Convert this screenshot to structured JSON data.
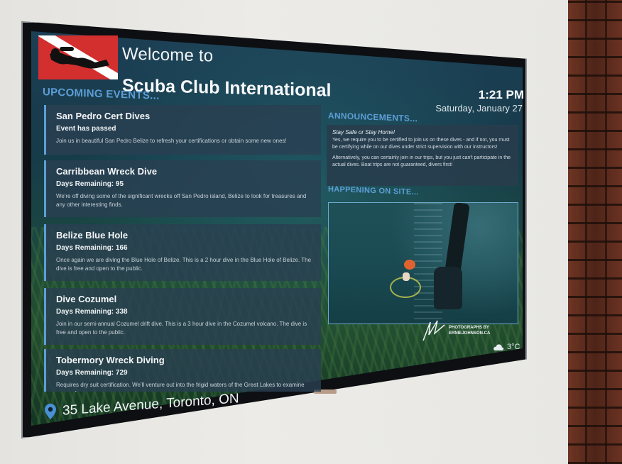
{
  "header": {
    "welcome": "Welcome to",
    "club_name": "Scuba Club International",
    "time": "1:21 PM",
    "date": "Saturday, January 27"
  },
  "events": {
    "title": "UPCOMING EVENTS...",
    "items": [
      {
        "name": "San Pedro Cert Dives",
        "status": "Event has passed",
        "description": "Join us in beautiful San Pedro Belize to refresh your certifications or obtain some new ones!"
      },
      {
        "name": "Carribbean Wreck Dive",
        "status": "Days Remaining: 95",
        "description": "We're off diving some of the significant wrecks off San Pedro island, Belize to look for treasures and any other interesting finds."
      },
      {
        "name": "Belize Blue Hole",
        "status": "Days Remaining: 166",
        "description": "Once again we are diving the Blue Hole of Belize. This is a 2 hour dive in the Blue Hole of Belize. The dive is free and open to the public."
      },
      {
        "name": "Dive Cozumel",
        "status": "Days Remaining: 338",
        "description": "Join in our semi-annual Cozumel drift dive. This is a 3 hour dive in the Cozumel volcano. The dive is free and open to the public."
      },
      {
        "name": "Tobermory Wreck Diving",
        "status": "Days Remaining: 729",
        "description": "Requires dry suit certification. We'll venture out into the frigid waters of the Great Lakes to examine some of"
      }
    ]
  },
  "announcements": {
    "title": "ANNOUNCEMENTS...",
    "heading": "Stay Safe or Stay Home!",
    "paragraph1": "Yes, we require you to be certified to join us on these dives - and if not, you must be certifying while on our dives under strict supervision with our instructors!",
    "paragraph2": "Alternatively, you can certainly join in our trips, but you just can't participate in the actual dives. Boat trips are not guaranteed, divers first!"
  },
  "happening": {
    "title": "HAPPENING ON SITE...",
    "credit_line1": "PHOTOGRAPHS BY",
    "credit_line2": "ERNIEJOHNSON.CA"
  },
  "weather": {
    "temperature": "3°C",
    "icon": "cloud-icon"
  },
  "footer": {
    "address": "35 Lake Avenue, Toronto, ON",
    "icon": "location-pin-icon"
  },
  "colors": {
    "accent": "#5d9ed6",
    "card_bg": "#2a4052",
    "flag_red": "#d32f2f"
  }
}
